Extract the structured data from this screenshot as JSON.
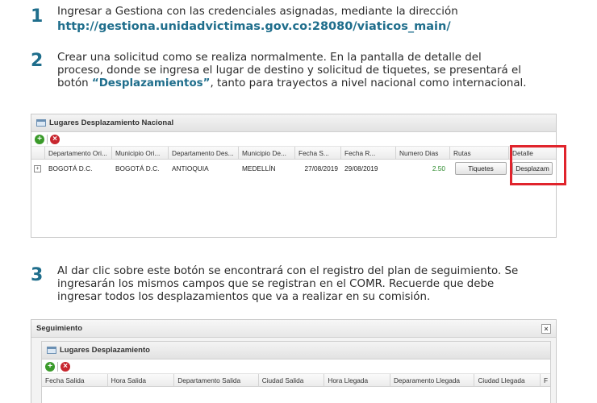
{
  "steps": [
    {
      "number": "1",
      "line1": "Ingresar a Gestiona con las credenciales asignadas, mediante la dirección",
      "link": "http://gestiona.unidadvictimas.gov.co:28080/viaticos_main/"
    },
    {
      "number": "2",
      "line1": "Crear una solicitud como se realiza normalmente. En la pantalla de detalle del",
      "line2": "proceso, donde se ingresa el lugar de destino y solicitud de tiquetes, se presentará el",
      "line3_pre": "botón ",
      "line3_hl": "“Desplazamientos”",
      "line3_post": ", tanto para trayectos a nivel nacional como internacional."
    },
    {
      "number": "3",
      "line1": "Al dar clic sobre este botón se encontrará con el registro del plan de seguimiento. Se",
      "line2": "ingresarán los mismos campos que se registran en el COMR. Recuerde que debe",
      "line3": "ingresar todos los desplazamientos que va a realizar en su comisión."
    }
  ],
  "screenshot1": {
    "panel_title": "Lugares Desplazamiento Nacional",
    "columns": [
      "Departamento Ori...",
      "Municipio Ori...",
      "Departamento Des...",
      "Municipio De...",
      "Fecha S...",
      "Fecha R...",
      "Numero Dias",
      "Rutas",
      "Detalle"
    ],
    "row": {
      "expand": "+",
      "dep_origen": "BOGOTÁ D.C.",
      "mun_origen": "BOGOTÁ D.C.",
      "dep_destino": "ANTIOQUIA",
      "mun_destino": "MEDELLÍN",
      "fecha_salida": "27/08/2019",
      "fecha_regreso": "29/08/2019",
      "numero_dias": "2.50",
      "rutas_button": "Tiquetes",
      "detalle_button": "Desplazam"
    }
  },
  "screenshot2": {
    "dialog_title": "Seguimiento",
    "close": "×",
    "panel_title": "Lugares Desplazamiento",
    "columns": [
      "Fecha Salida",
      "Hora Salida",
      "Departamento Salida",
      "Ciudad Salida",
      "Hora Llegada",
      "Deparamento Llegada",
      "Ciudad Llegada",
      "F"
    ]
  },
  "toolbar": {
    "add": "+",
    "delete": "×"
  },
  "colors": {
    "accent": "#1f6e8c",
    "highlight_box": "#e0242c"
  }
}
